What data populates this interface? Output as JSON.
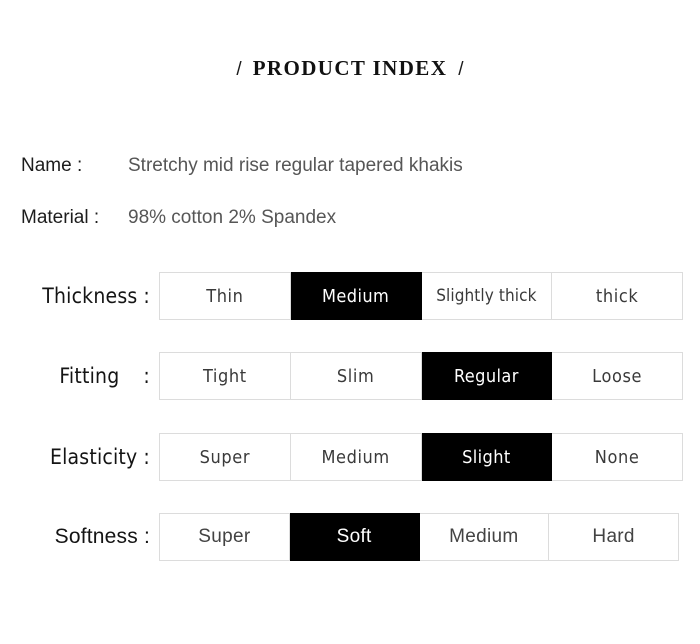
{
  "header": {
    "slash_left": "/",
    "title": "PRODUCT INDEX",
    "slash_right": "/"
  },
  "info": [
    {
      "label": "Name :",
      "value": "Stretchy mid rise regular tapered khakis"
    },
    {
      "label": "Material :",
      "value": "98% cotton 2% Spandex"
    }
  ],
  "specs": [
    {
      "label": "Thickness",
      "colon": ":",
      "options": [
        {
          "text": "Thin",
          "selected": false
        },
        {
          "text": "Medium",
          "selected": true
        },
        {
          "text": "Slightly thick",
          "selected": false
        },
        {
          "text": "thick",
          "selected": false
        }
      ]
    },
    {
      "label": "Fitting",
      "colon": ":",
      "options": [
        {
          "text": "Tight",
          "selected": false
        },
        {
          "text": "Slim",
          "selected": false
        },
        {
          "text": "Regular",
          "selected": true
        },
        {
          "text": "Loose",
          "selected": false
        }
      ]
    },
    {
      "label": "Elasticity",
      "colon": ":",
      "options": [
        {
          "text": "Super",
          "selected": false
        },
        {
          "text": "Medium",
          "selected": false
        },
        {
          "text": "Slight",
          "selected": true
        },
        {
          "text": "None",
          "selected": false
        }
      ]
    },
    {
      "label": "Softness",
      "colon": ":",
      "options": [
        {
          "text": "Super",
          "selected": false
        },
        {
          "text": "Soft",
          "selected": true
        },
        {
          "text": "Medium",
          "selected": false
        },
        {
          "text": "Hard",
          "selected": false
        }
      ]
    }
  ],
  "colors": {
    "page_background": "#ffffff",
    "selected_background": "#000000",
    "selected_text": "#ffffff",
    "cell_border": "#dcdcdc",
    "label_text": "#141414",
    "value_text": "#565656"
  }
}
